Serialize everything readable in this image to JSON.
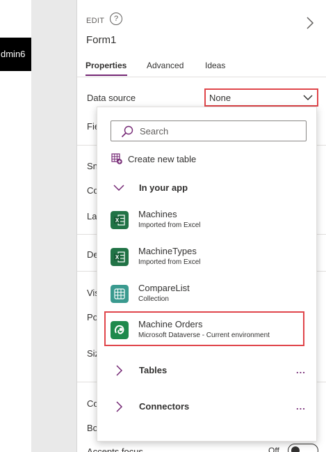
{
  "canvas": {
    "control_text": "dmin6"
  },
  "panel": {
    "edit_label": "EDIT",
    "help_glyph": "?",
    "title": "Form1",
    "tabs": [
      {
        "label": "Properties",
        "active": true
      },
      {
        "label": "Advanced",
        "active": false
      },
      {
        "label": "Ideas",
        "active": false
      }
    ],
    "properties": {
      "data_source": {
        "label": "Data source",
        "value": "None"
      },
      "fields": "Fie",
      "snap": "Sn",
      "columns": "Co",
      "layout": "La",
      "default_mode": "De",
      "visible": "Vis",
      "position": "Po",
      "size": "Siz",
      "color": "Co",
      "border": "Bo",
      "accepts_focus": {
        "label": "Accepts focus",
        "toggle_label": "Off",
        "on": false
      }
    }
  },
  "dropdown": {
    "search_placeholder": "Search",
    "create_new": "Create new table",
    "groups": {
      "in_your_app": "In your app",
      "tables": "Tables",
      "connectors": "Connectors",
      "more": "..."
    },
    "items": [
      {
        "name": "Machines",
        "subtitle": "Imported from Excel",
        "icon": "excel-icon"
      },
      {
        "name": "MachineTypes",
        "subtitle": "Imported from Excel",
        "icon": "excel-icon"
      },
      {
        "name": "CompareList",
        "subtitle": "Collection",
        "icon": "collection-icon"
      },
      {
        "name": "Machine Orders",
        "subtitle": "Microsoft Dataverse - Current environment",
        "icon": "dataverse-icon"
      }
    ]
  },
  "colors": {
    "accent": "#742774",
    "highlight": "#e0454a",
    "excel": "#217346",
    "collection": "#3a9a8f",
    "dataverse": "#1e8a4c"
  }
}
